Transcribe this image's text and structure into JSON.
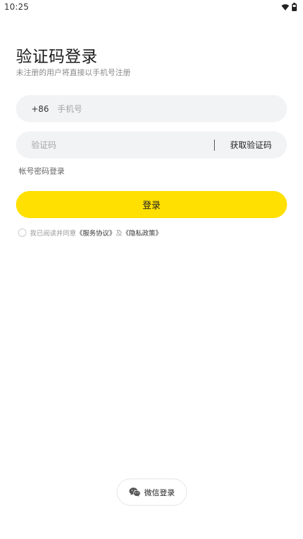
{
  "status_bar": {
    "time": "10:25"
  },
  "header": {
    "title": "验证码登录",
    "subtitle": "未注册的用户将直接以手机号注册"
  },
  "phone_field": {
    "country_code": "+86",
    "placeholder": "手机号"
  },
  "code_field": {
    "placeholder": "验证码",
    "get_code_label": "获取验证码"
  },
  "password_login_label": "帐号密码登录",
  "login_button_label": "登录",
  "agreement": {
    "prefix": "我已阅读并同意",
    "service_link": "《服务协议》",
    "conjunction": "及",
    "privacy_link": "《隐私政策》",
    "checked": false
  },
  "wechat_login_label": "微信登录",
  "colors": {
    "accent": "#ffe000",
    "field_bg": "#f2f3f5"
  },
  "icons": [
    "wifi-icon",
    "battery-icon",
    "wechat-icon"
  ]
}
